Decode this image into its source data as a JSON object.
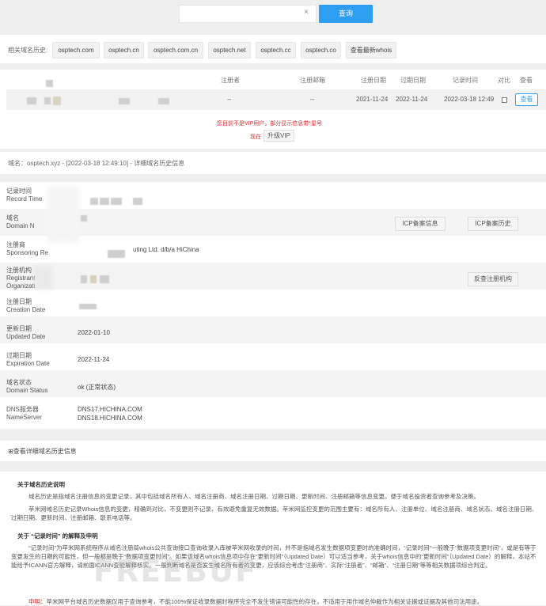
{
  "search": {
    "button_label": "查询",
    "clear_icon": "×"
  },
  "related": {
    "label": "相关域名历史:",
    "domains": [
      "osptech.com",
      "osptech.cn",
      "osptech.com.cn",
      "osptech.net",
      "osptech.cc",
      "osptech.co"
    ],
    "more_label": "查看最新whois"
  },
  "records": {
    "headers": {
      "registrant": "注册者",
      "email": "注册邮箱",
      "created": "注册日期",
      "expires": "过期日期",
      "record_time": "记录时间",
      "compare": "对比",
      "view": "查看"
    },
    "row": {
      "registrant": "--",
      "email": "--",
      "created": "2021-11-24",
      "expires": "2022-11-24",
      "record_time": "2022-03-18 12:49",
      "view_label": "查看"
    },
    "vip_notice": "您目前不是VIP用户，部分显示信息带*星号",
    "now_label": "现在",
    "upgrade_label": "升级VIP"
  },
  "detail": {
    "title": "域名：osptech.xyz - [2022-03-18 12:49:10] - 详细域名历史信息",
    "rows": [
      {
        "cn": "记录时间",
        "en": "Record Time",
        "value": ""
      },
      {
        "cn": "域名",
        "en": "Domain N",
        "value": ""
      },
      {
        "cn": "注册商",
        "en": "Sponsoring Re",
        "value": "uting Ltd. d/b/a HiChina"
      },
      {
        "cn": "注册机构",
        "en": "Registrant Organizati",
        "value": ""
      },
      {
        "cn": "注册日期",
        "en": "Creation Date",
        "value": ""
      },
      {
        "cn": "更新日期",
        "en": "Updated Date",
        "value": "2022-01-10"
      },
      {
        "cn": "过期日期",
        "en": "Expiration Date",
        "value": "2022-11-24"
      },
      {
        "cn": "域名状态",
        "en": "Domain Status",
        "value": "ok (正常状态)"
      },
      {
        "cn": "DNS服务器",
        "en": "NameServer",
        "value": "DNS17.HICHINA.COM",
        "value2": "DNS18.HICHINA.COM"
      }
    ],
    "icp_info_label": "ICP备案信息",
    "icp_history_label": "ICP备案历史",
    "reverse_label": "反查注册机构"
  },
  "expand": {
    "icon": "⊞",
    "label": "查看详细域名历史信息"
  },
  "notes": {
    "title1": "关于域名历史说明",
    "p1": "域名历史是指域名注册信息的变更记录，其中包括域名所有人、域名注册商、域名注册日期、过期日期、更新时间、注册邮箱等信息变更。便于域名投资者查询参考及决策。",
    "p2": "苹米网域名历史记录Whois信息的变更，精确到对比，不变更则不记录，有效避免重复无效数据。苹米网监控变更的范围主要有：域名所有人、注册单位、域名注册商、域名状态、域名注册日期、过期日期、更新时间、注册邮箱、联系电话等。",
    "title2": "关于 “记录时间” 的解释及申明",
    "p3": "“记录时间”为苹米网系统程序从域名注册局whois公共查询接口查询收录入库被苹米网收录的时间，并不是指域名发生数据项变更时的准确时间，“记录时间”一般晚于“数据项变更时间”，或是有等于变更发生的日期的可能性，但一般都是晚于“数据项变更时间”。如果该域名whois信息项中存在“更新时间”（Updated Date）可以适当参考，关于whois信息中的“更新时间”（Updated Date）的解释，本站不能给予ICANN官方解释，请前面ICANN查验解释核实。一般判断域名是否发生域名所有者的变更，应该综合考虑“注册商”、实际“注册者”、“邮箱”、“注册日期”等等相关数据项综合判定。",
    "p4_red": "申明",
    "p4": "：苹米网平台域名历史数据仅用于查询参考，不能100%保证收录数据时程序完全不发生错误可能性的存在，不适用于用作域名仲裁作为相关证据或证据及其他司法用途。"
  },
  "watermark": "FREEBUF"
}
